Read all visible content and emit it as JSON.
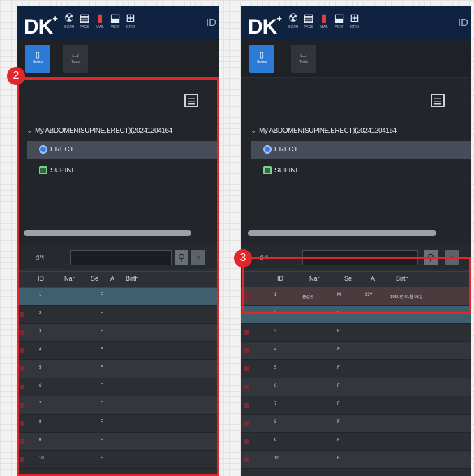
{
  "brand": {
    "logo_text": "DK",
    "logo_sup": "+"
  },
  "toolbar": {
    "items": [
      {
        "glyph": "☢",
        "label": "SCAN"
      },
      {
        "glyph": "▤",
        "label": "PACS"
      },
      {
        "glyph": "▮",
        "label": "MWL"
      },
      {
        "glyph": "⬓",
        "label": "VIEW"
      },
      {
        "glyph": "⊞",
        "label": "GRID"
      }
    ],
    "id_label": "ID"
  },
  "tabs": [
    {
      "label": "Series",
      "glyph": "▯",
      "active": true
    },
    {
      "label": "Tools",
      "glyph": "▭",
      "active": false
    }
  ],
  "study": {
    "chevron": "⌄",
    "label": "My ABDOMEN(SUPINE,ERECT)(20241204164"
  },
  "series": [
    {
      "label": "ERECT",
      "icon": "info-icon",
      "selected": true
    },
    {
      "label": "SUPINE",
      "icon": "film-icon",
      "selected": false
    }
  ],
  "search": {
    "label": "검색",
    "placeholder": "",
    "search_glyph": "⚲",
    "clear_glyph": "×"
  },
  "table": {
    "headers": [
      "ID",
      "Nar",
      "Se",
      "A",
      "Birth"
    ],
    "left_rows": [
      {
        "id": "1",
        "sex": "F"
      },
      {
        "id": "2",
        "sex": "F"
      },
      {
        "id": "3",
        "sex": "F"
      },
      {
        "id": "4",
        "sex": "F"
      },
      {
        "id": "5",
        "sex": "F"
      },
      {
        "id": "6",
        "sex": "F"
      },
      {
        "id": "7",
        "sex": "F"
      },
      {
        "id": "8",
        "sex": "F"
      },
      {
        "id": "9",
        "sex": "F"
      },
      {
        "id": "10",
        "sex": "F"
      }
    ],
    "right_rows": [
      {
        "id": "1",
        "name": "홍길동",
        "sex": "M",
        "age": "33Y",
        "birth": "1990년 01월 01일"
      },
      {
        "id": "2",
        "name": "",
        "sex": "F",
        "age": "",
        "birth": ""
      },
      {
        "id": "3",
        "name": "",
        "sex": "F",
        "age": "",
        "birth": ""
      },
      {
        "id": "4",
        "name": "",
        "sex": "F",
        "age": "",
        "birth": ""
      },
      {
        "id": "5",
        "name": "",
        "sex": "F",
        "age": "",
        "birth": ""
      },
      {
        "id": "6",
        "name": "",
        "sex": "F",
        "age": "",
        "birth": ""
      },
      {
        "id": "7",
        "name": "",
        "sex": "F",
        "age": "",
        "birth": ""
      },
      {
        "id": "8",
        "name": "",
        "sex": "F",
        "age": "",
        "birth": ""
      },
      {
        "id": "9",
        "name": "",
        "sex": "F",
        "age": "",
        "birth": ""
      },
      {
        "id": "10",
        "name": "",
        "sex": "F",
        "age": "",
        "birth": ""
      }
    ]
  },
  "callouts": [
    {
      "number": "2"
    },
    {
      "number": "3"
    }
  ],
  "colors": {
    "accent": "#e3262a",
    "header_bar": "#0f2340",
    "active_tab": "#2a7ad6"
  }
}
